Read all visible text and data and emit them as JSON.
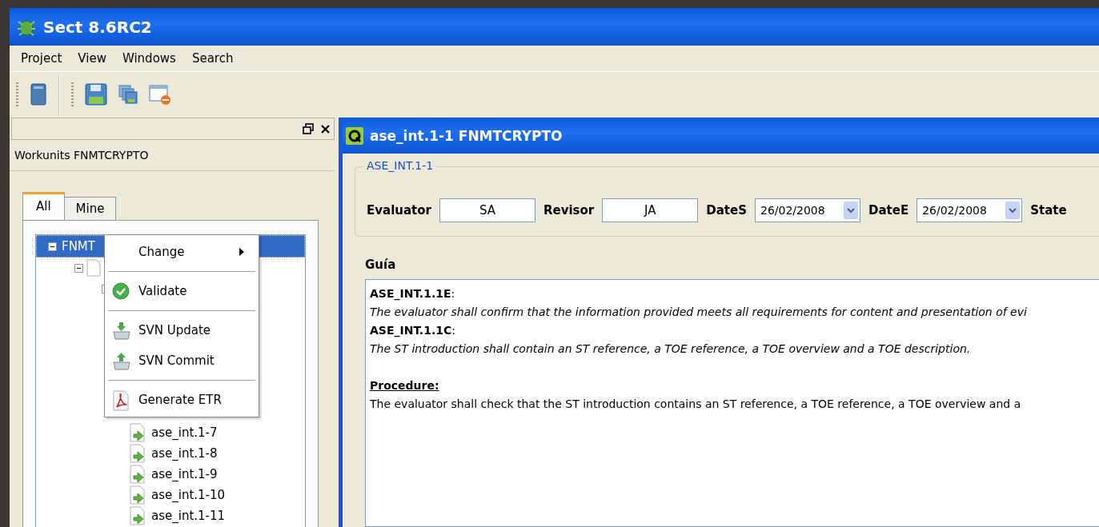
{
  "window": {
    "title": "Sect 8.6RC2"
  },
  "menu": [
    "Project",
    "View",
    "Windows",
    "Search"
  ],
  "left_panel": {
    "title": "Workunits FNMTCRYPTO",
    "tabs": [
      {
        "label": "All",
        "selected": true
      },
      {
        "label": "Mine",
        "selected": false
      }
    ],
    "tree": [
      {
        "label": "FNMT",
        "selected": true,
        "expanded": true,
        "children": [
          {
            "expanded": true,
            "children": [
              {
                "expanded": true,
                "children": [
                  {
                    "label": "ase_int.1-7"
                  },
                  {
                    "label": "ase_int.1-8"
                  },
                  {
                    "label": "ase_int.1-9"
                  },
                  {
                    "label": "ase_int.1-10"
                  },
                  {
                    "label": "ase_int.1-11"
                  }
                ]
              }
            ]
          }
        ]
      }
    ]
  },
  "context_menu": [
    {
      "kind": "submenu",
      "label": "Change"
    },
    {
      "kind": "separator"
    },
    {
      "kind": "check",
      "label": "Validate"
    },
    {
      "kind": "separator"
    },
    {
      "kind": "update",
      "label": "SVN Update"
    },
    {
      "kind": "commit",
      "label": "SVN Commit"
    },
    {
      "kind": "separator"
    },
    {
      "kind": "pdf",
      "label": "Generate ETR"
    }
  ],
  "editor": {
    "title": "ase_int.1-1 FNMTCRYPTO",
    "group_title": "ASE_INT.1-1",
    "fields": [
      {
        "kind": "text",
        "label": "Evaluator",
        "value": "SA"
      },
      {
        "kind": "text",
        "label": "Revisor",
        "value": "JA"
      },
      {
        "kind": "date",
        "label": "DateS",
        "value": "26/02/2008"
      },
      {
        "kind": "date",
        "label": "DateE",
        "value": "26/02/2008"
      },
      {
        "kind": "label",
        "label": "State"
      }
    ],
    "guide_label": "Guía",
    "guide": [
      {
        "kind": "heading",
        "text": "**ASE_INT.1.1E**:"
      },
      {
        "kind": "italic",
        "text": "The evaluator shall confirm that the information provided meets all requirements for content and presentation of evi"
      },
      {
        "kind": "heading",
        "text": "**ASE_INT.1.1C**:"
      },
      {
        "kind": "italic",
        "text": "The ST introduction shall contain an ST reference, a TOE reference, a TOE overview and a TOE description."
      },
      {
        "kind": "section",
        "text": "Procedure:"
      },
      {
        "kind": "plain",
        "text": "The evaluator shall check that the ST introduction contains an ST reference, a TOE reference, a TOE overview and a"
      }
    ]
  }
}
